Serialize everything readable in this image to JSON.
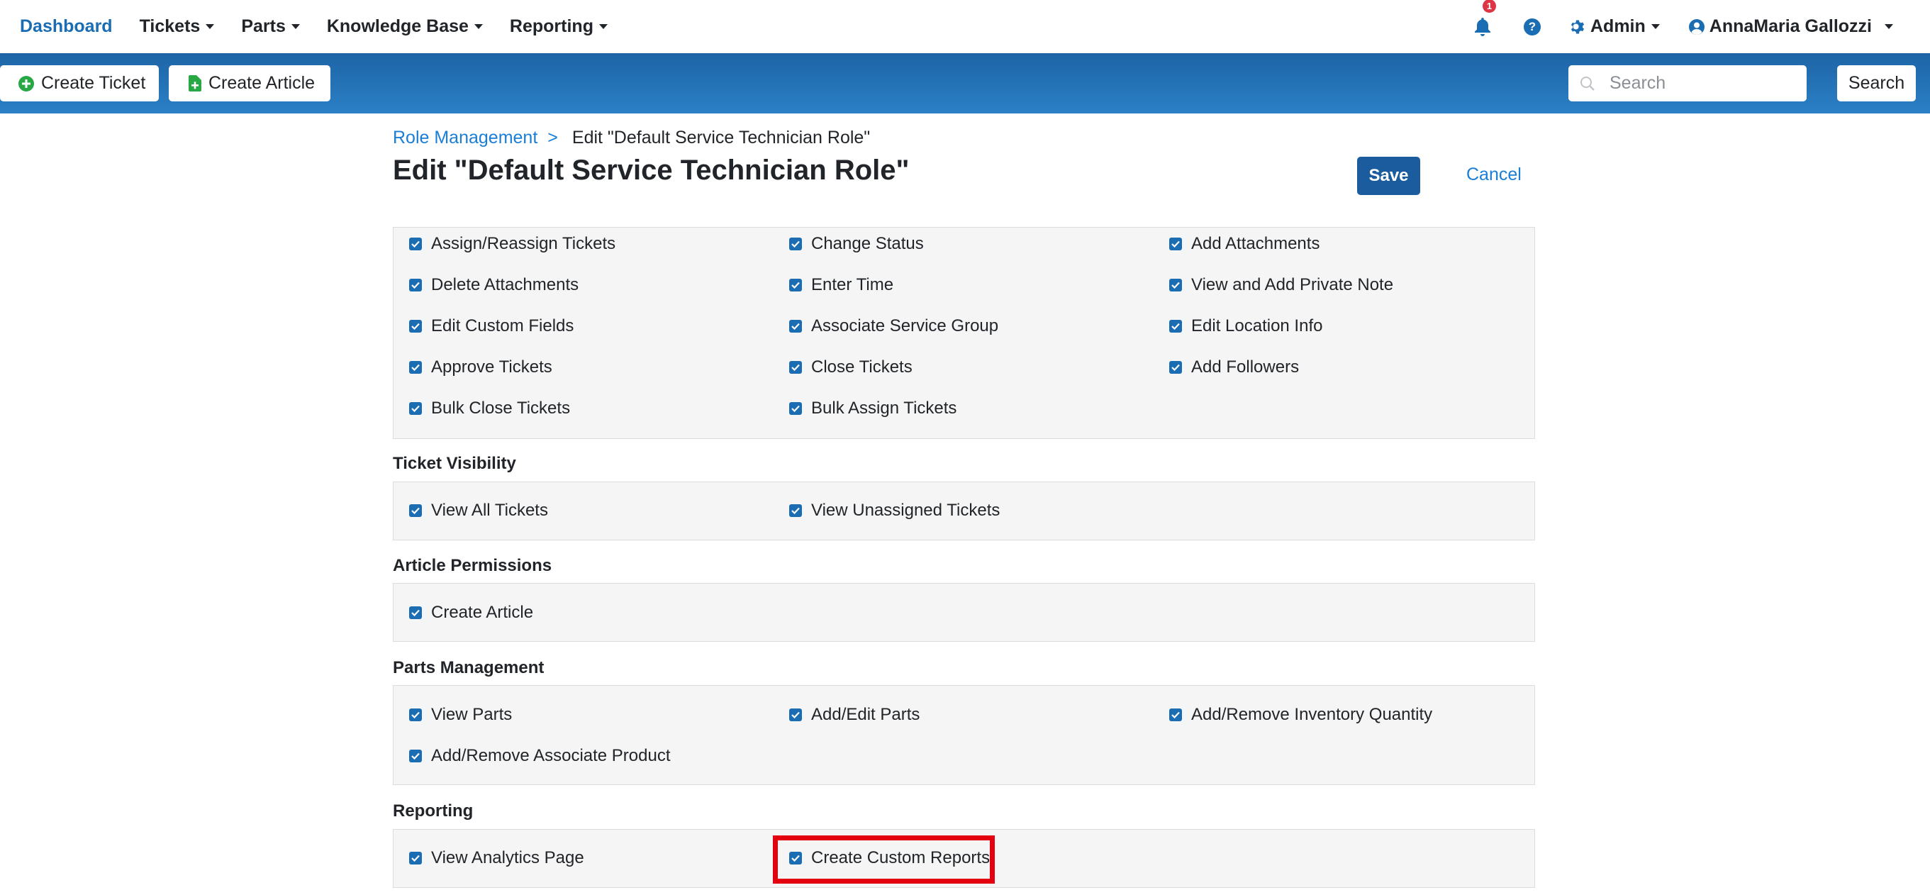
{
  "nav": {
    "dashboard": "Dashboard",
    "tickets": "Tickets",
    "parts": "Parts",
    "knowledge_base": "Knowledge Base",
    "reporting": "Reporting",
    "notification_count": "1",
    "help": "?",
    "admin": "Admin",
    "user": "AnnaMaria Gallozzi"
  },
  "toolbar": {
    "create_ticket": "Create Ticket",
    "create_article": "Create Article",
    "search_placeholder": "Search",
    "search_button": "Search"
  },
  "header": {
    "breadcrumb_link": "Role Management",
    "breadcrumb_sep": ">",
    "breadcrumb_current": "Edit \"Default Service Technician Role\"",
    "title": "Edit \"Default Service Technician Role\"",
    "save": "Save",
    "cancel": "Cancel"
  },
  "sections": {
    "ticket_actions": {
      "items": [
        "Assign/Reassign Tickets",
        "Change Status",
        "Add Attachments",
        "Delete Attachments",
        "Enter Time",
        "View and Add Private Note",
        "Edit Custom Fields",
        "Associate Service Group",
        "Edit Location Info",
        "Approve Tickets",
        "Close Tickets",
        "Add Followers",
        "Bulk Close Tickets",
        "Bulk Assign Tickets"
      ]
    },
    "ticket_visibility": {
      "title": "Ticket Visibility",
      "items": [
        "View All Tickets",
        "View Unassigned Tickets"
      ]
    },
    "article_permissions": {
      "title": "Article Permissions",
      "items": [
        "Create Article"
      ]
    },
    "parts_management": {
      "title": "Parts Management",
      "items": [
        "View Parts",
        "Add/Edit Parts",
        "Add/Remove Inventory Quantity",
        "Add/Remove Associate Product"
      ]
    },
    "reporting": {
      "title": "Reporting",
      "items": [
        "View Analytics Page",
        "Create Custom Reports"
      ]
    }
  },
  "colors": {
    "accent": "#1a6db3",
    "toolbar_top": "#1d64a6",
    "toolbar_bottom": "#2b80c6",
    "highlight": "#e3000f",
    "badge": "#dc3545"
  }
}
